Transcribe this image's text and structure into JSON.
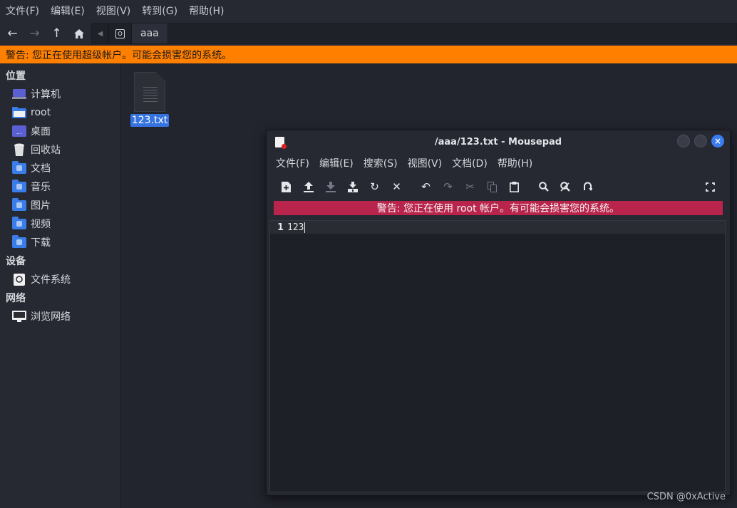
{
  "file_manager": {
    "menu": [
      "文件(F)",
      "编辑(E)",
      "视图(V)",
      "转到(G)",
      "帮助(H)"
    ],
    "path": {
      "crumb": "aaa"
    },
    "warning": "警告: 您正在使用超级帐户。可能会损害您的系统。",
    "sidebar": {
      "places_heading": "位置",
      "places": [
        "计算机",
        "root",
        "桌面",
        "回收站",
        "文档",
        "音乐",
        "图片",
        "视频",
        "下载"
      ],
      "devices_heading": "设备",
      "devices": [
        "文件系统"
      ],
      "network_heading": "网络",
      "network": [
        "浏览网络"
      ]
    },
    "files": [
      {
        "name": "123.txt",
        "selected": true
      }
    ]
  },
  "mousepad": {
    "title": "/aaa/123.txt - Mousepad",
    "menu": [
      "文件(F)",
      "编辑(E)",
      "搜索(S)",
      "视图(V)",
      "文档(D)",
      "帮助(H)"
    ],
    "warning": "警告: 您正在使用 root 帐户。有可能会损害您的系统。",
    "lines": [
      {
        "num": "1",
        "text": "123"
      }
    ]
  },
  "watermark": "CSDN @0xActive",
  "colors": {
    "warning_orange": "#ff7f00",
    "warning_red": "#b8244b",
    "selection": "#3574e0",
    "close_button": "#3a7cf0"
  }
}
